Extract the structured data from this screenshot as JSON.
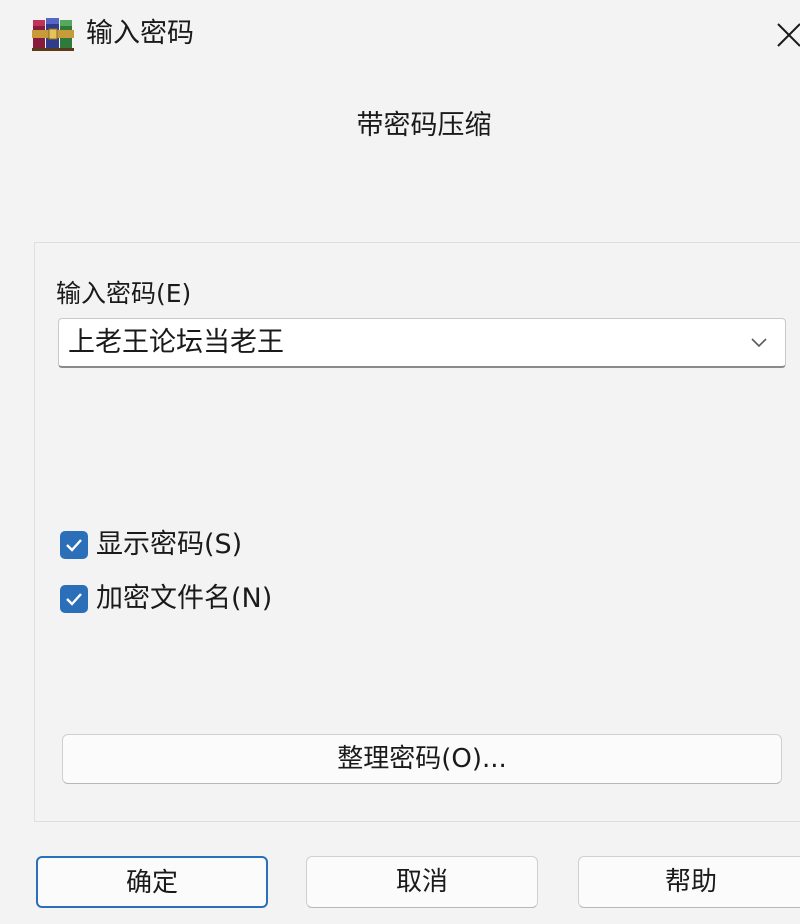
{
  "window": {
    "title": "输入密码",
    "icon": "winrar-books-icon",
    "close_icon": "close-icon"
  },
  "heading": "带密码压缩",
  "password": {
    "label": "输入密码(E)",
    "value": "上老王论坛当老王",
    "dropdown_icon": "chevron-down-icon"
  },
  "options": {
    "show_password": {
      "label": "显示密码(S)",
      "checked": true
    },
    "encrypt_filenames": {
      "label": "加密文件名(N)",
      "checked": true
    }
  },
  "buttons": {
    "manage": "整理密码(O)...",
    "ok": "确定",
    "cancel": "取消",
    "help": "帮助"
  },
  "colors": {
    "accent": "#2a6fb8",
    "window_bg": "#f3f3f3"
  }
}
